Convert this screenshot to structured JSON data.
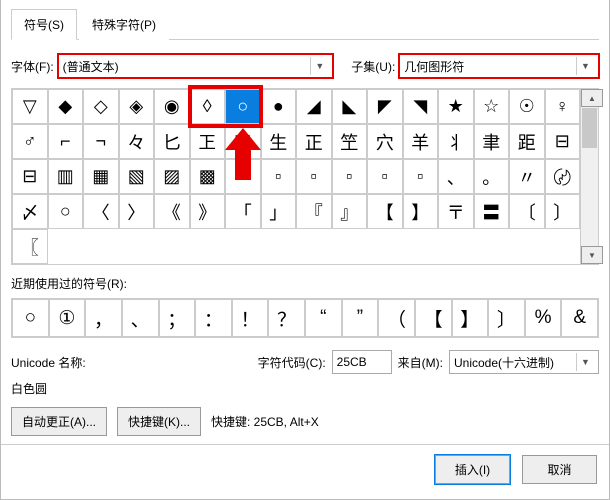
{
  "tabs": {
    "symbols": "符号(S)",
    "special": "特殊字符(P)"
  },
  "font": {
    "label": "字体(F):",
    "value": "(普通文本)"
  },
  "subset": {
    "label": "子集(U):",
    "value": "几何图形符"
  },
  "grid": {
    "rows": [
      [
        "▽",
        "◆",
        "◇",
        "◈",
        "◉",
        "◊",
        "○",
        "●",
        "◢",
        "◣",
        "◤",
        "◥",
        "★",
        "☆",
        "☉",
        "♀",
        "♂"
      ],
      [
        "⌐",
        "¬",
        "々",
        "匕",
        "㠪",
        "凹",
        "生",
        "正",
        "笁",
        "穴",
        "羊",
        "丬",
        "聿",
        "距",
        "⊟",
        "⊟"
      ],
      [
        "▥",
        "▦",
        "▧",
        "▨",
        "▩",
        "▫",
        "▫",
        "▫",
        "▫",
        "▫",
        "▫",
        "、",
        "。",
        "〃",
        "〄",
        "〆"
      ],
      [
        "○",
        "〈",
        "〉",
        "《",
        "》",
        "「",
        "」",
        "『",
        "』",
        "【",
        "】",
        "〒",
        "〓",
        "〔",
        "〕",
        "〖"
      ]
    ],
    "selected": {
      "row": 0,
      "col": 6
    }
  },
  "recent": {
    "label": "近期使用过的符号(R):",
    "items": [
      "○",
      "①",
      "，",
      "、",
      "；",
      "：",
      "！",
      "？",
      "“",
      "”",
      "（",
      "【",
      "】",
      "〕",
      "%",
      "&"
    ]
  },
  "unicode": {
    "name_label": "Unicode 名称:",
    "char_name": "白色圆",
    "code_label": "字符代码(C):",
    "code_value": "25CB",
    "from_label": "来自(M):",
    "from_value": "Unicode(十六进制)"
  },
  "buttons": {
    "autocorrect": "自动更正(A)...",
    "shortcut": "快捷键(K)...",
    "shortcut_label": "快捷键: 25CB, Alt+X",
    "insert": "插入(I)",
    "cancel": "取消"
  }
}
